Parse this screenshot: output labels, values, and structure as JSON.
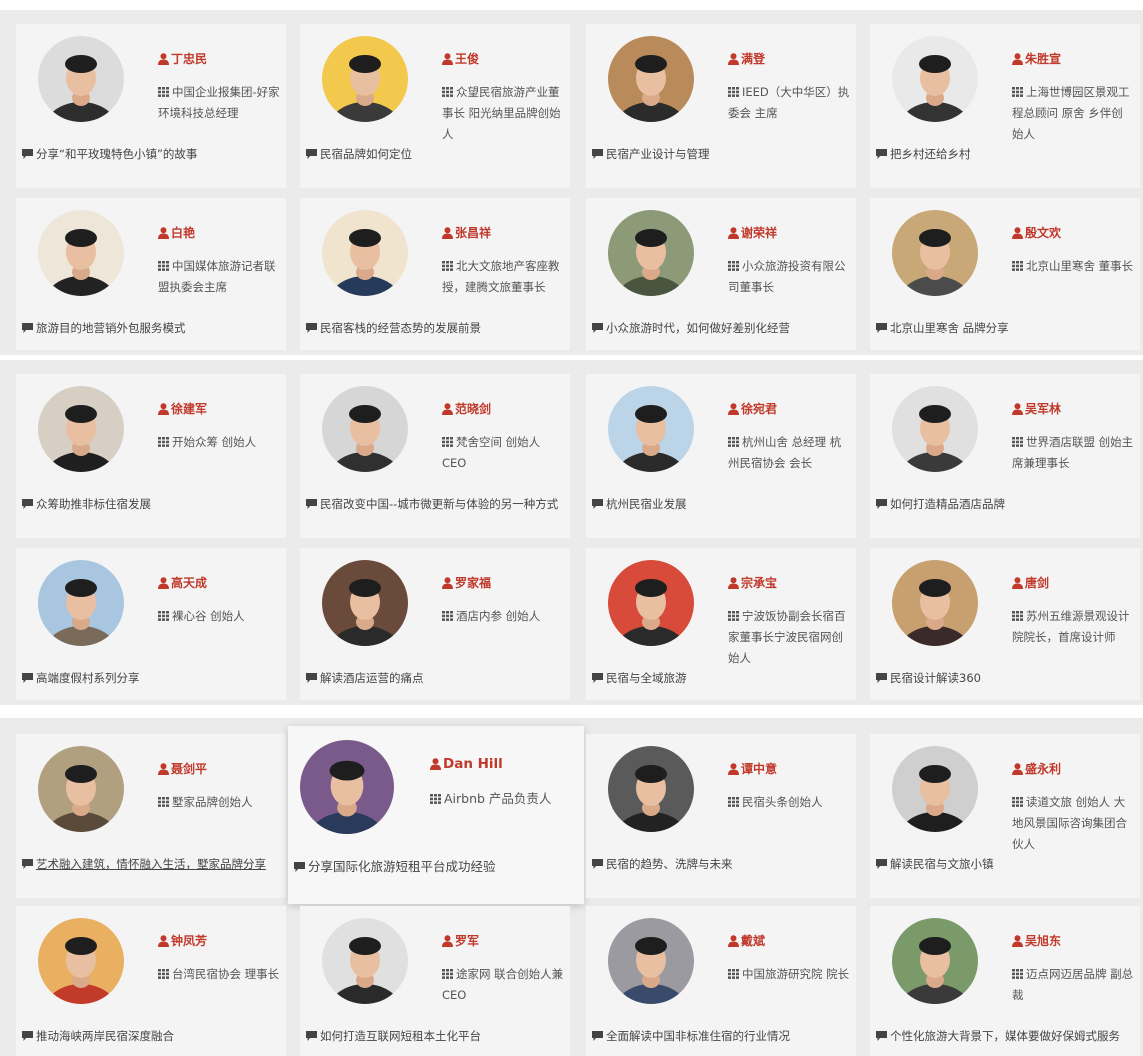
{
  "colors": {
    "name": "#c0392b",
    "band": "#ebebeb",
    "card": "#f4f4f4"
  },
  "speakers": [
    {
      "name": "丁忠民",
      "title": "中国企业报集团-好家环境科技总经理",
      "topic": "分享“和平玫瑰特色小镇”的故事",
      "tone": "#2d2d2d",
      "bg": "#dcdcdc"
    },
    {
      "name": "王俊",
      "title": "众望民宿旅游产业董事长 阳光纳里品牌创始人",
      "topic": "民宿品牌如何定位",
      "tone": "#3a3a3a",
      "bg": "#f2c94c"
    },
    {
      "name": "满登",
      "title": "IEED（大中华区）执委会 主席",
      "topic": "民宿产业设计与管理",
      "tone": "#2b2b2b",
      "bg": "#b98a5a"
    },
    {
      "name": "朱胜宣",
      "title": "上海世博园区景观工程总顾问 原舍 乡伴创始人",
      "topic": "把乡村还给乡村",
      "tone": "#333",
      "bg": "#e9e9e9"
    },
    {
      "name": "白艳",
      "title": "中国媒体旅游记者联盟执委会主席",
      "topic": "旅游目的地营销外包服务模式",
      "tone": "#222",
      "bg": "#efe6da"
    },
    {
      "name": "张昌祥",
      "title": "北大文旅地产客座教授，建腾文旅董事长",
      "topic": "民宿客栈的经营态势的发展前景",
      "tone": "#263a5a",
      "bg": "#f0e4cf"
    },
    {
      "name": "谢荣祥",
      "title": "小众旅游投资有限公司董事长",
      "topic": "小众旅游时代，如何做好差别化经营",
      "tone": "#4a5540",
      "bg": "#8c9a77"
    },
    {
      "name": "殷文欢",
      "title": "北京山里寒舍 董事长",
      "topic": "北京山里寒舍 品牌分享",
      "tone": "#4b4b4b",
      "bg": "#c9a878"
    },
    {
      "name": "徐建军",
      "title": "开始众筹 创始人",
      "topic": "众筹助推非标住宿发展",
      "tone": "#1f1f1f",
      "bg": "#d8cfc4"
    },
    {
      "name": "范晓剑",
      "title": "梵舍空间 创始人 CEO",
      "topic": "民宿改变中国--城市微更新与体验的另一种方式",
      "tone": "#303030",
      "bg": "#d6d6d6"
    },
    {
      "name": "徐宛君",
      "title": "杭州山舍 总经理 杭州民宿协会 会长",
      "topic": "杭州民宿业发展",
      "tone": "#2a2a2a",
      "bg": "#bcd4e8"
    },
    {
      "name": "吴军林",
      "title": "世界酒店联盟 创始主席兼理事长",
      "topic": "如何打造精品酒店品牌",
      "tone": "#3a3a3a",
      "bg": "#e0e0e0"
    },
    {
      "name": "高天成",
      "title": "裸心谷 创始人",
      "topic": "高端度假村系列分享",
      "tone": "#7a6a5a",
      "bg": "#a8c6e0"
    },
    {
      "name": "罗家福",
      "title": "酒店内参 创始人",
      "topic": "解读酒店运营的痛点",
      "tone": "#2a2a2a",
      "bg": "#6a4a3a"
    },
    {
      "name": "宗承宝",
      "title": "宁波饭协副会长宿百家董事长宁波民宿网创始人",
      "topic": "民宿与全域旅游",
      "tone": "#2a2a2a",
      "bg": "#d84a3a"
    },
    {
      "name": "唐剑",
      "title": "苏州五维源景观设计院院长，首席设计师",
      "topic": "民宿设计解读360",
      "tone": "#3a2a2a",
      "bg": "#c8a070"
    },
    {
      "name": "聂剑平",
      "title": "墅家品牌创始人",
      "topic": "艺术融入建筑，情怀融入生活，墅家品牌分享",
      "tone": "#5a4a3a",
      "bg": "#b0a080"
    },
    {
      "name": "Dan Hill",
      "title": "Airbnb 产品负责人",
      "topic": "分享国际化旅游短租平台成功经验",
      "tone": "#2a3a5a",
      "bg": "#7a5a8a"
    },
    {
      "name": "谭中意",
      "title": "民宿头条创始人",
      "topic": "民宿的趋势、洗牌与未来",
      "tone": "#222",
      "bg": "#5a5a5a"
    },
    {
      "name": "盛永利",
      "title": "读道文旅 创始人 大地风景国际咨询集团合伙人",
      "topic": "解读民宿与文旅小镇",
      "tone": "#1e1e1e",
      "bg": "#cfcfcf"
    },
    {
      "name": "钟凤芳",
      "title": "台湾民宿协会 理事长",
      "topic": "推动海峡两岸民宿深度融合",
      "tone": "#c23a2a",
      "bg": "#e8b060"
    },
    {
      "name": "罗军",
      "title": "途家网 联合创始人兼 CEO",
      "topic": "如何打造互联网短租本土化平台",
      "tone": "#2a2a2a",
      "bg": "#e0e0e0"
    },
    {
      "name": "戴斌",
      "title": "中国旅游研究院 院长",
      "topic": "全面解读中国非标准住宿的行业情况",
      "tone": "#3a4a6a",
      "bg": "#9a9aa0"
    },
    {
      "name": "吴旭东",
      "title": "迈点网迈居品牌 副总裁",
      "topic": "个性化旅游大背景下，媒体要做好保姆式服务",
      "tone": "#3a3a3a",
      "bg": "#7a9a6a"
    }
  ]
}
